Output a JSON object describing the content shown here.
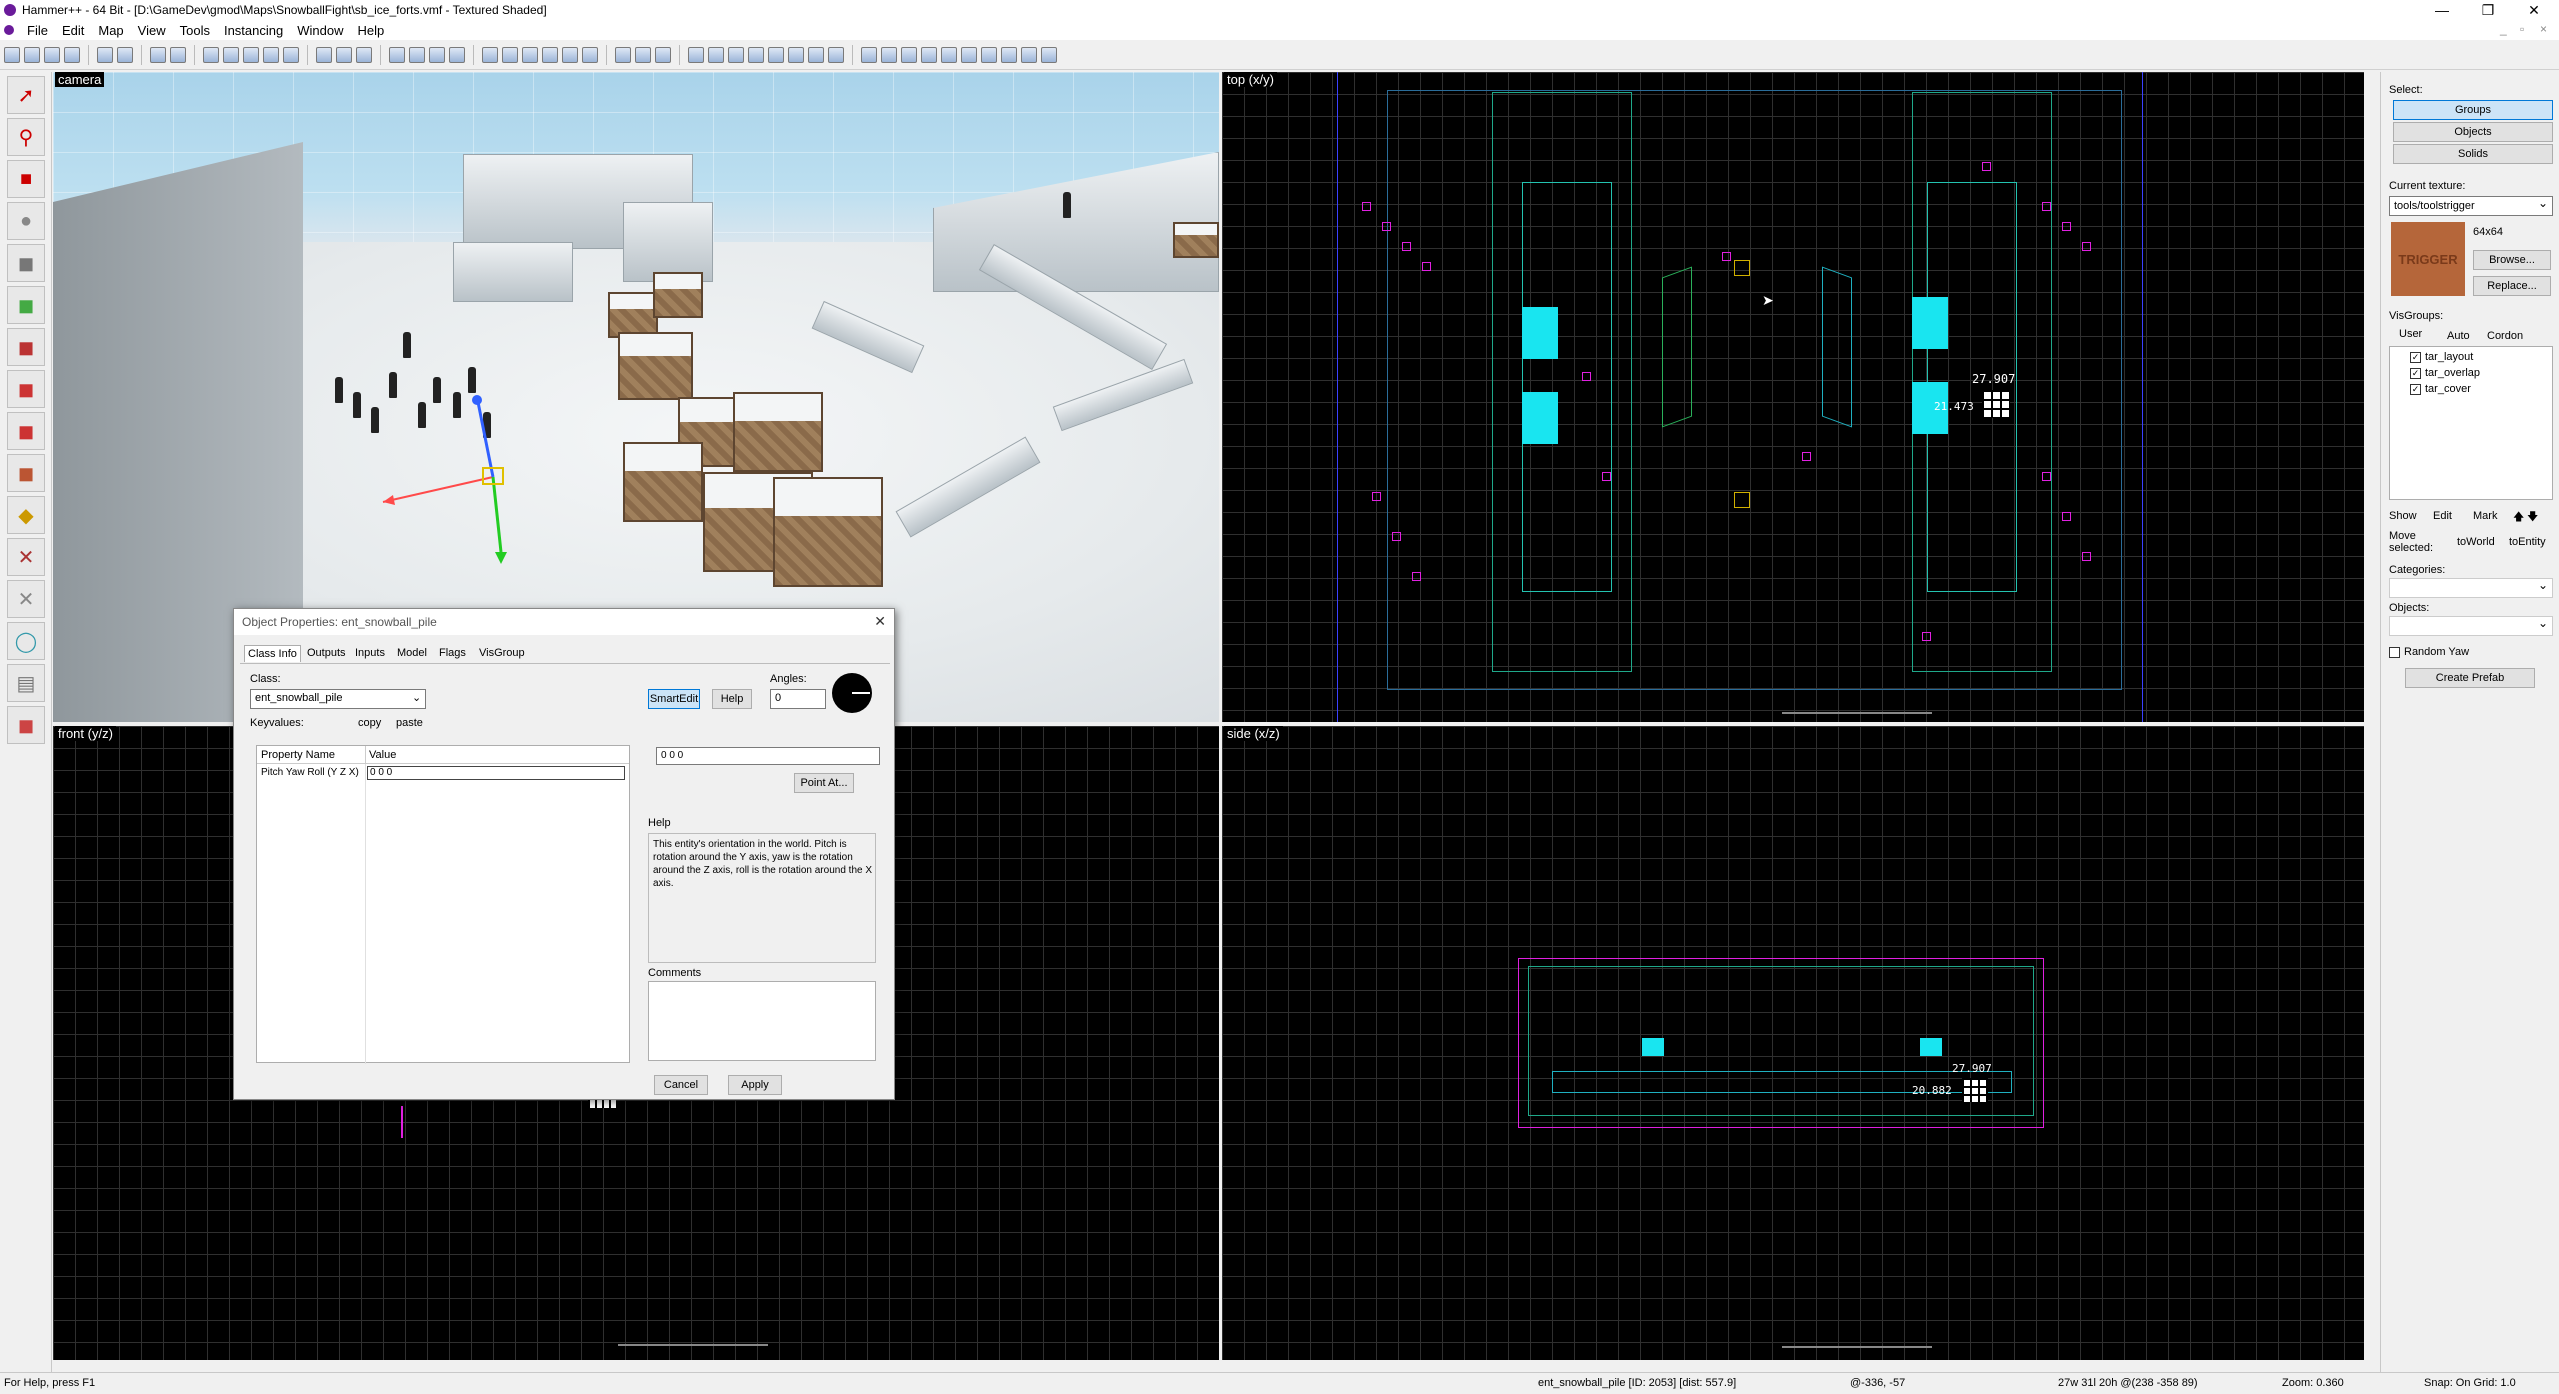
{
  "window": {
    "title": "Hammer++ - 64 Bit - [D:\\GameDev\\gmod\\Maps\\SnowballFight\\sb_ice_forts.vmf - Textured Shaded]",
    "controls": [
      "—",
      "❐",
      "✕"
    ]
  },
  "menu": [
    "File",
    "Edit",
    "Map",
    "View",
    "Tools",
    "Instancing",
    "Window",
    "Help"
  ],
  "viewports": {
    "camera": "camera",
    "top": "top (x/y)",
    "front": "front (y/z)",
    "side": "side (x/z)"
  },
  "top_view": {
    "measure_width": "27.907",
    "measure_height": "21.473"
  },
  "side_view": {
    "measure_width": "27.907",
    "measure_height": "20.882"
  },
  "right_panel": {
    "select_label": "Select:",
    "select_buttons": [
      "Groups",
      "Objects",
      "Solids"
    ],
    "current_texture_label": "Current texture:",
    "current_texture": "tools/toolstrigger",
    "texture_size": "64x64",
    "texture_preview_text": "TRIGGER",
    "browse": "Browse...",
    "replace": "Replace...",
    "visgroups_label": "VisGroups:",
    "visgroup_tabs": [
      "User",
      "Auto",
      "Cordon"
    ],
    "visgroups": [
      "tar_layout",
      "tar_overlap",
      "tar_cover"
    ],
    "show": "Show",
    "edit": "Edit",
    "mark": "Mark",
    "move_selected": "Move selected:",
    "to_world": "toWorld",
    "to_entity": "toEntity",
    "categories_label": "Categories:",
    "objects_label": "Objects:",
    "random_yaw": "Random Yaw",
    "create_prefab": "Create Prefab"
  },
  "dialog": {
    "title": "Object Properties: ent_snowball_pile",
    "tabs": [
      "Class Info",
      "Outputs",
      "Inputs",
      "Model",
      "Flags",
      "VisGroup"
    ],
    "class_label": "Class:",
    "class_value": "ent_snowball_pile",
    "keyvalues_label": "Keyvalues:",
    "copy": "copy",
    "paste": "paste",
    "smartedit": "SmartEdit",
    "help_btn": "Help",
    "angles_label": "Angles:",
    "angles_value": "0",
    "table_headers": [
      "Property Name",
      "Value"
    ],
    "rows": [
      {
        "name": "Pitch Yaw Roll (Y Z X)",
        "value": "0 0 0"
      }
    ],
    "value_field": "0 0 0",
    "point_at": "Point At...",
    "help_label": "Help",
    "help_text": "This entity's orientation in the world. Pitch is rotation around the Y axis, yaw is the rotation around the Z axis, roll is the rotation around the X axis.",
    "comments_label": "Comments",
    "cancel": "Cancel",
    "apply": "Apply"
  },
  "status": {
    "help": "For Help, press F1",
    "selection": "ent_snowball_pile [ID: 2053] [dist: 557.9]",
    "cursor": "@-336, -57",
    "dims": "27w 31l 20h @(238 -358 89)",
    "zoom": "Zoom: 0.360",
    "snap": "Snap: On Grid: 1.0"
  }
}
